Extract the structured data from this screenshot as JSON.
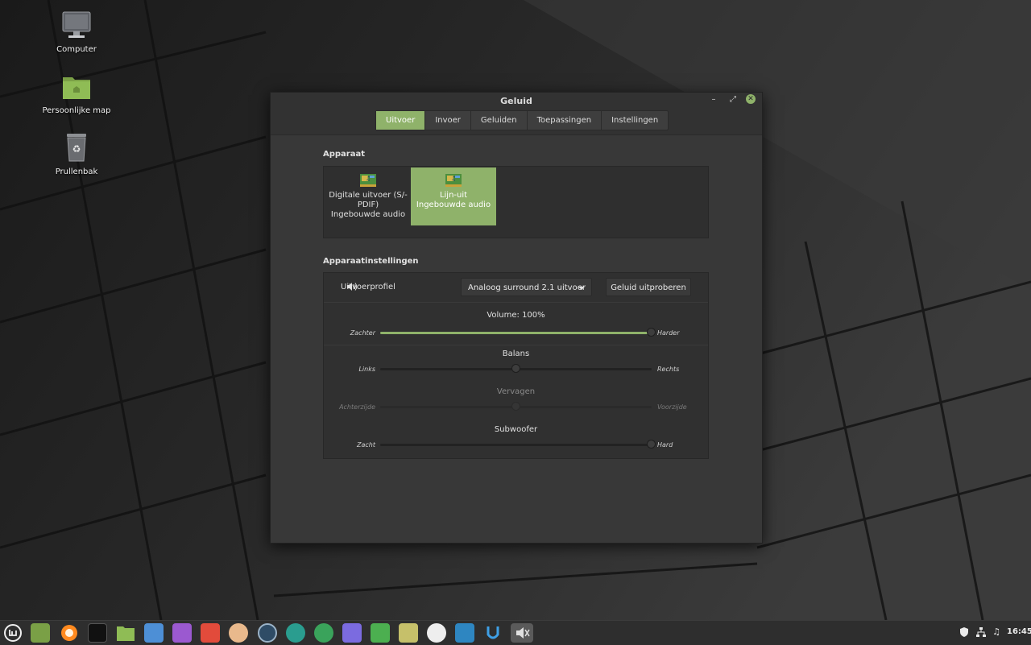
{
  "desktop": {
    "icons": [
      {
        "label": "Computer",
        "icon": "computer-icon"
      },
      {
        "label": "Persoonlijke map",
        "icon": "home-folder-icon"
      },
      {
        "label": "Prullenbak",
        "icon": "trash-icon"
      }
    ]
  },
  "window": {
    "title": "Geluid",
    "controls": {
      "minimize": "–",
      "maximize": "⤢",
      "close": "✕"
    },
    "tabs": [
      {
        "label": "Uitvoer",
        "active": true
      },
      {
        "label": "Invoer",
        "active": false
      },
      {
        "label": "Geluiden",
        "active": false
      },
      {
        "label": "Toepassingen",
        "active": false
      },
      {
        "label": "Instellingen",
        "active": false
      }
    ]
  },
  "device_section": {
    "title": "Apparaat",
    "devices": [
      {
        "name": "Digitale uitvoer (S/-PDIF)",
        "line1": "Digitale uitvoer (S/-",
        "line2": "PDIF)",
        "line3": "Ingebouwde audio",
        "selected": false
      },
      {
        "name": "Lijn-uit",
        "line1": "Lijn-uit",
        "line2": "Ingebouwde audio",
        "selected": true
      }
    ]
  },
  "settings_section": {
    "title": "Apparaatinstellingen",
    "profile_label": "Uitvoerprofiel",
    "profile_value": "Analoog surround 2.1 uitvoer",
    "test_button": "Geluid uitproberen",
    "volume": {
      "title": "Volume: 100%",
      "left": "Zachter",
      "right": "Harder",
      "value_percent": 100
    },
    "balance": {
      "title": "Balans",
      "left": "Links",
      "right": "Rechts",
      "value_fraction": 0.5
    },
    "fade": {
      "title": "Vervagen",
      "left": "Achterzijde",
      "right": "Voorzijde",
      "value_fraction": 0.5,
      "disabled": true
    },
    "subwoofer": {
      "title": "Subwoofer",
      "left": "Zacht",
      "right": "Hard",
      "value_fraction": 1.0
    }
  },
  "taskbar": {
    "apps": [
      "mint-menu-icon",
      "show-desktop-icon",
      "firefox-icon",
      "terminal-icon",
      "files-icon",
      "mail-icon",
      "drawing-icon",
      "screenshot-icon",
      "hand-icon",
      "browser-icon",
      "updater-icon",
      "backup-icon",
      "graphics-icon",
      "software-icon",
      "image-icon",
      "drive-icon",
      "settings-icon",
      "u-icon",
      "sound-settings-icon"
    ],
    "tray": [
      "shield-icon",
      "network-icon",
      "music-note-icon"
    ],
    "clock": "16:45"
  },
  "colors": {
    "accent": "#8fb26a",
    "window_bg": "#383838",
    "panel_bg": "#2e2e2e"
  }
}
